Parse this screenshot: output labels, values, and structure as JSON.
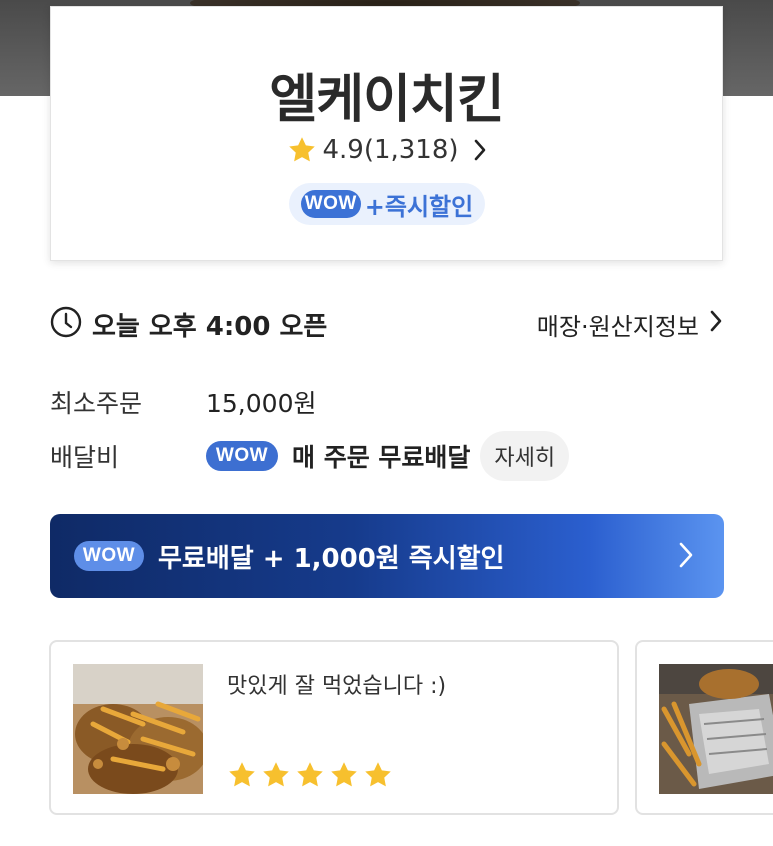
{
  "store": {
    "name": "엘케이치킨",
    "rating": "4.9",
    "review_count": "(1,318)",
    "wow_badge": "WOW",
    "wow_benefit": "+즉시할인"
  },
  "hours": {
    "open_text": "오늘 오후 4:00 오픈",
    "store_info_link": "매장·원산지정보"
  },
  "order_info": {
    "min_order_label": "최소주문",
    "min_order_value": "15,000원",
    "delivery_fee_label": "배달비",
    "delivery_wow_badge": "WOW",
    "delivery_free_text": "매 주문 무료배달",
    "detail_button": "자세히"
  },
  "promo_banner": {
    "wow_badge": "WOW",
    "text": "무료배달 + 1,000원 즉시할인"
  },
  "reviews": [
    {
      "text": "맛있게 잘 먹었습니다 :)",
      "stars": 5
    }
  ],
  "colors": {
    "wow_blue": "#3c72d6",
    "star_yellow": "#f7c02e",
    "banner_dark": "#0f2a66",
    "banner_light": "#5b94f0"
  },
  "icons": [
    "star-icon",
    "chevron-right-icon",
    "clock-icon"
  ]
}
